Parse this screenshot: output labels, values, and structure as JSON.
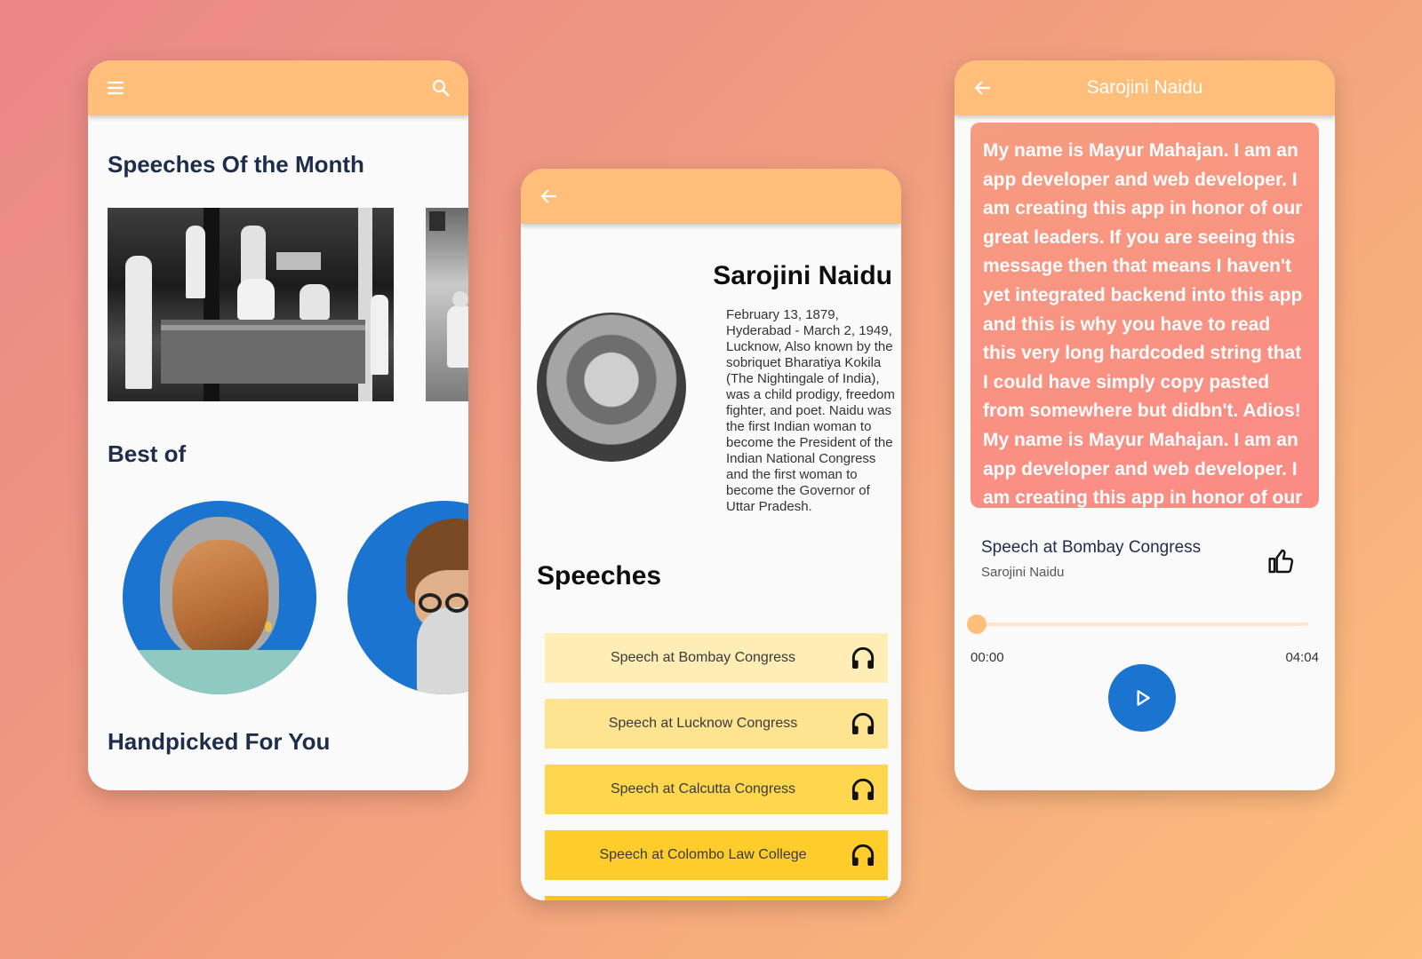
{
  "home": {
    "menu_icon": "menu-icon",
    "search_icon": "search-icon",
    "section_month": "Speeches Of the Month",
    "section_best": "Best of",
    "section_handpicked": "Handpicked For You"
  },
  "detail": {
    "back_icon": "arrow-back-icon",
    "name": "Sarojini Naidu",
    "bio": "February 13, 1879, Hyderabad - March 2, 1949, Lucknow, Also known by the sobriquet Bharatiya Kokila (The Nightingale of India), was a child prodigy, freedom fighter, and poet. Naidu was the first Indian woman to become the President of the Indian National Congress and the first woman to become the Governor of Uttar Pradesh.",
    "speeches_title": "Speeches",
    "speeches": [
      {
        "label": "Speech at Bombay Congress",
        "color": "#feedb4"
      },
      {
        "label": "Speech at Lucknow Congress",
        "color": "#fee391"
      },
      {
        "label": "Speech at Calcutta Congress",
        "color": "#ffd74e"
      },
      {
        "label": "Speech at Colombo Law College",
        "color": "#fecd2b"
      }
    ]
  },
  "player": {
    "back_icon": "arrow-back-icon",
    "title": "Sarojini Naidu",
    "message": "My name is Mayur Mahajan. I am an app developer and web developer. I am creating this app in honor of our great leaders. If you are seeing this message then that means I haven't yet integrated backend into this app and this is why you have to read this very long hardcoded string that I could have simply copy pasted from somewhere but didbn't. Adios! My name is Mayur Mahajan. I am an app developer and web developer. I am creating this app in honor of our",
    "track_title": "Speech at Bombay Congress",
    "track_artist": "Sarojini Naidu",
    "time_current": "00:00",
    "time_total": "04:04",
    "progress": 0
  },
  "colors": {
    "appbar": "#ffbf7a",
    "blue": "#1b74cf",
    "navy_text": "#1e2d4a"
  }
}
